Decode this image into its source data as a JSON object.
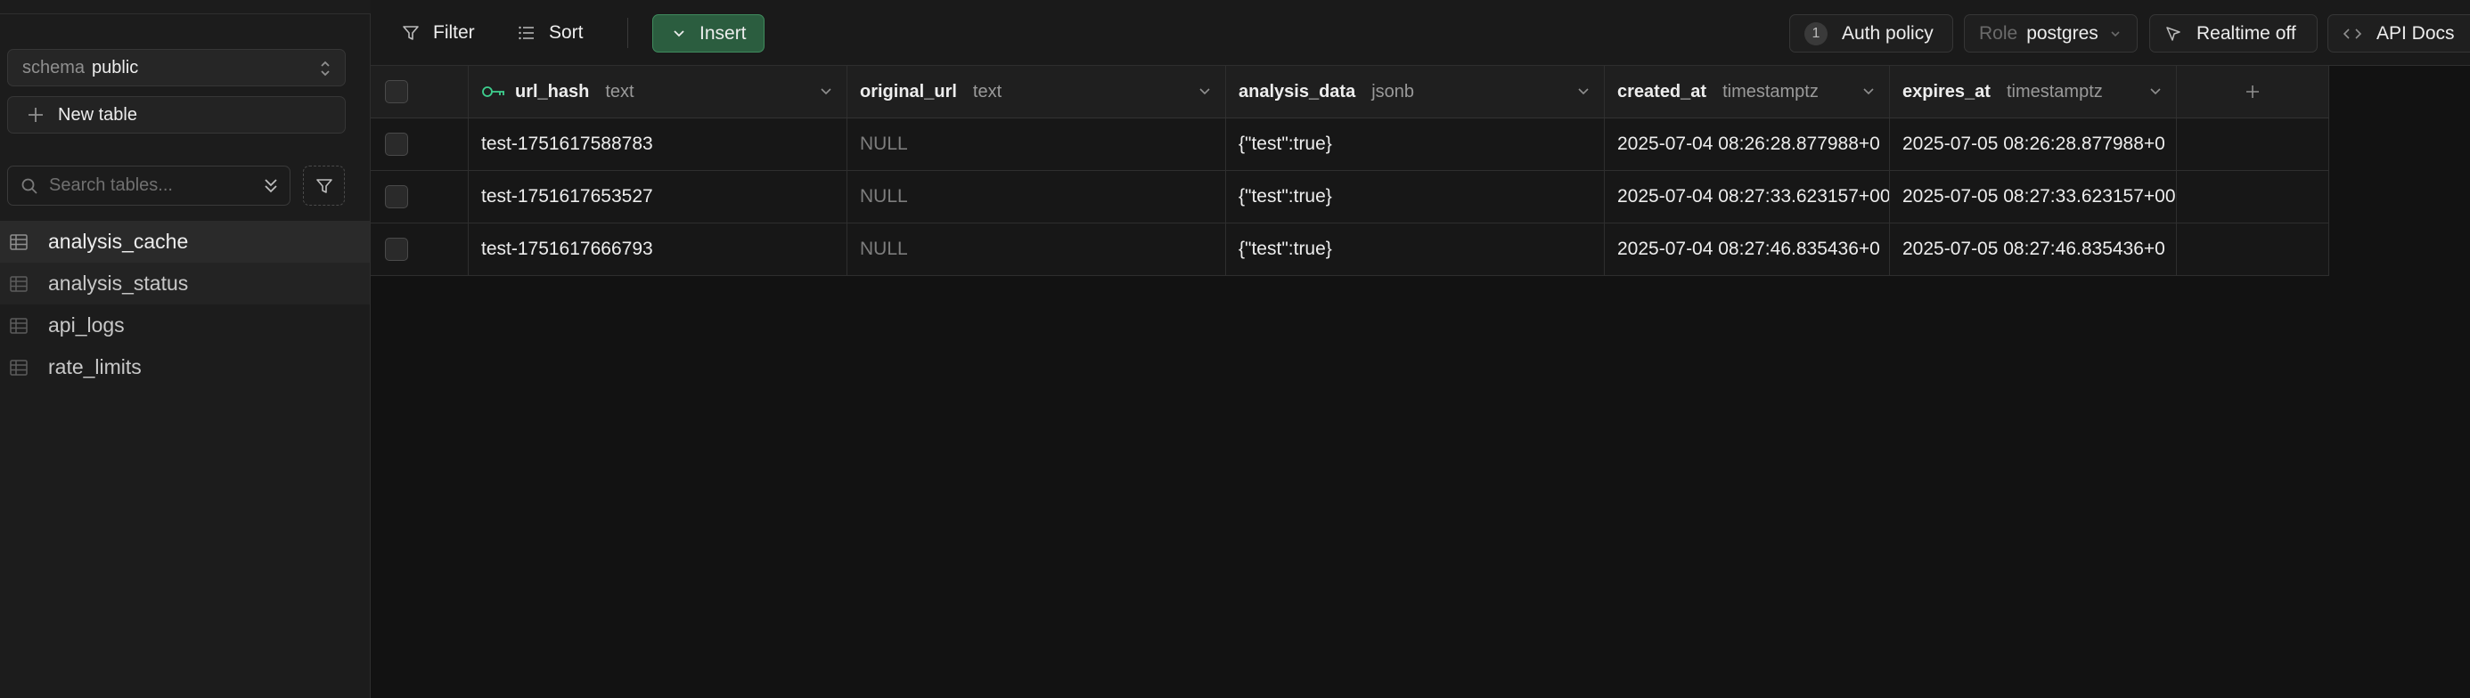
{
  "sidebar": {
    "schema_label": "schema",
    "schema_value": "public",
    "new_table_label": "New table",
    "search_placeholder": "Search tables...",
    "tables": [
      {
        "name": "analysis_cache",
        "state": "active"
      },
      {
        "name": "analysis_status",
        "state": "hover"
      },
      {
        "name": "api_logs",
        "state": ""
      },
      {
        "name": "rate_limits",
        "state": ""
      }
    ]
  },
  "toolbar": {
    "filter_label": "Filter",
    "sort_label": "Sort",
    "insert_label": "Insert",
    "auth_policy_count": "1",
    "auth_policy_label": "Auth policy",
    "role_label": "Role",
    "role_value": "postgres",
    "realtime_label": "Realtime off",
    "api_docs_label": "API Docs"
  },
  "grid": {
    "columns": [
      {
        "name": "url_hash",
        "type": "text",
        "primary_key": true
      },
      {
        "name": "original_url",
        "type": "text"
      },
      {
        "name": "analysis_data",
        "type": "jsonb"
      },
      {
        "name": "created_at",
        "type": "timestamptz"
      },
      {
        "name": "expires_at",
        "type": "timestamptz"
      }
    ],
    "rows": [
      [
        "test-1751617588783",
        "NULL",
        "{\"test\":true}",
        "2025-07-04 08:26:28.877988+0",
        "2025-07-05 08:26:28.877988+0"
      ],
      [
        "test-1751617653527",
        "NULL",
        "{\"test\":true}",
        "2025-07-04 08:27:33.623157+00",
        "2025-07-05 08:27:33.623157+00"
      ],
      [
        "test-1751617666793",
        "NULL",
        "{\"test\":true}",
        "2025-07-04 08:27:46.835436+0",
        "2025-07-05 08:27:46.835436+0"
      ]
    ]
  },
  "icons": {
    "filter": "filter-icon",
    "sort": "list-icon",
    "insert": "chevron-down-icon",
    "realtime": "broadcast-icon",
    "api_docs": "code-icon",
    "key": "key-icon",
    "table": "table-icon",
    "search": "search-icon",
    "add_column": "plus-icon"
  },
  "colors": {
    "background": "#121212",
    "sidebar": "#1c1c1c",
    "insert_bg": "#2b5d3f",
    "insert_border": "#3f8b5d",
    "key_icon": "#3ecf8e"
  }
}
